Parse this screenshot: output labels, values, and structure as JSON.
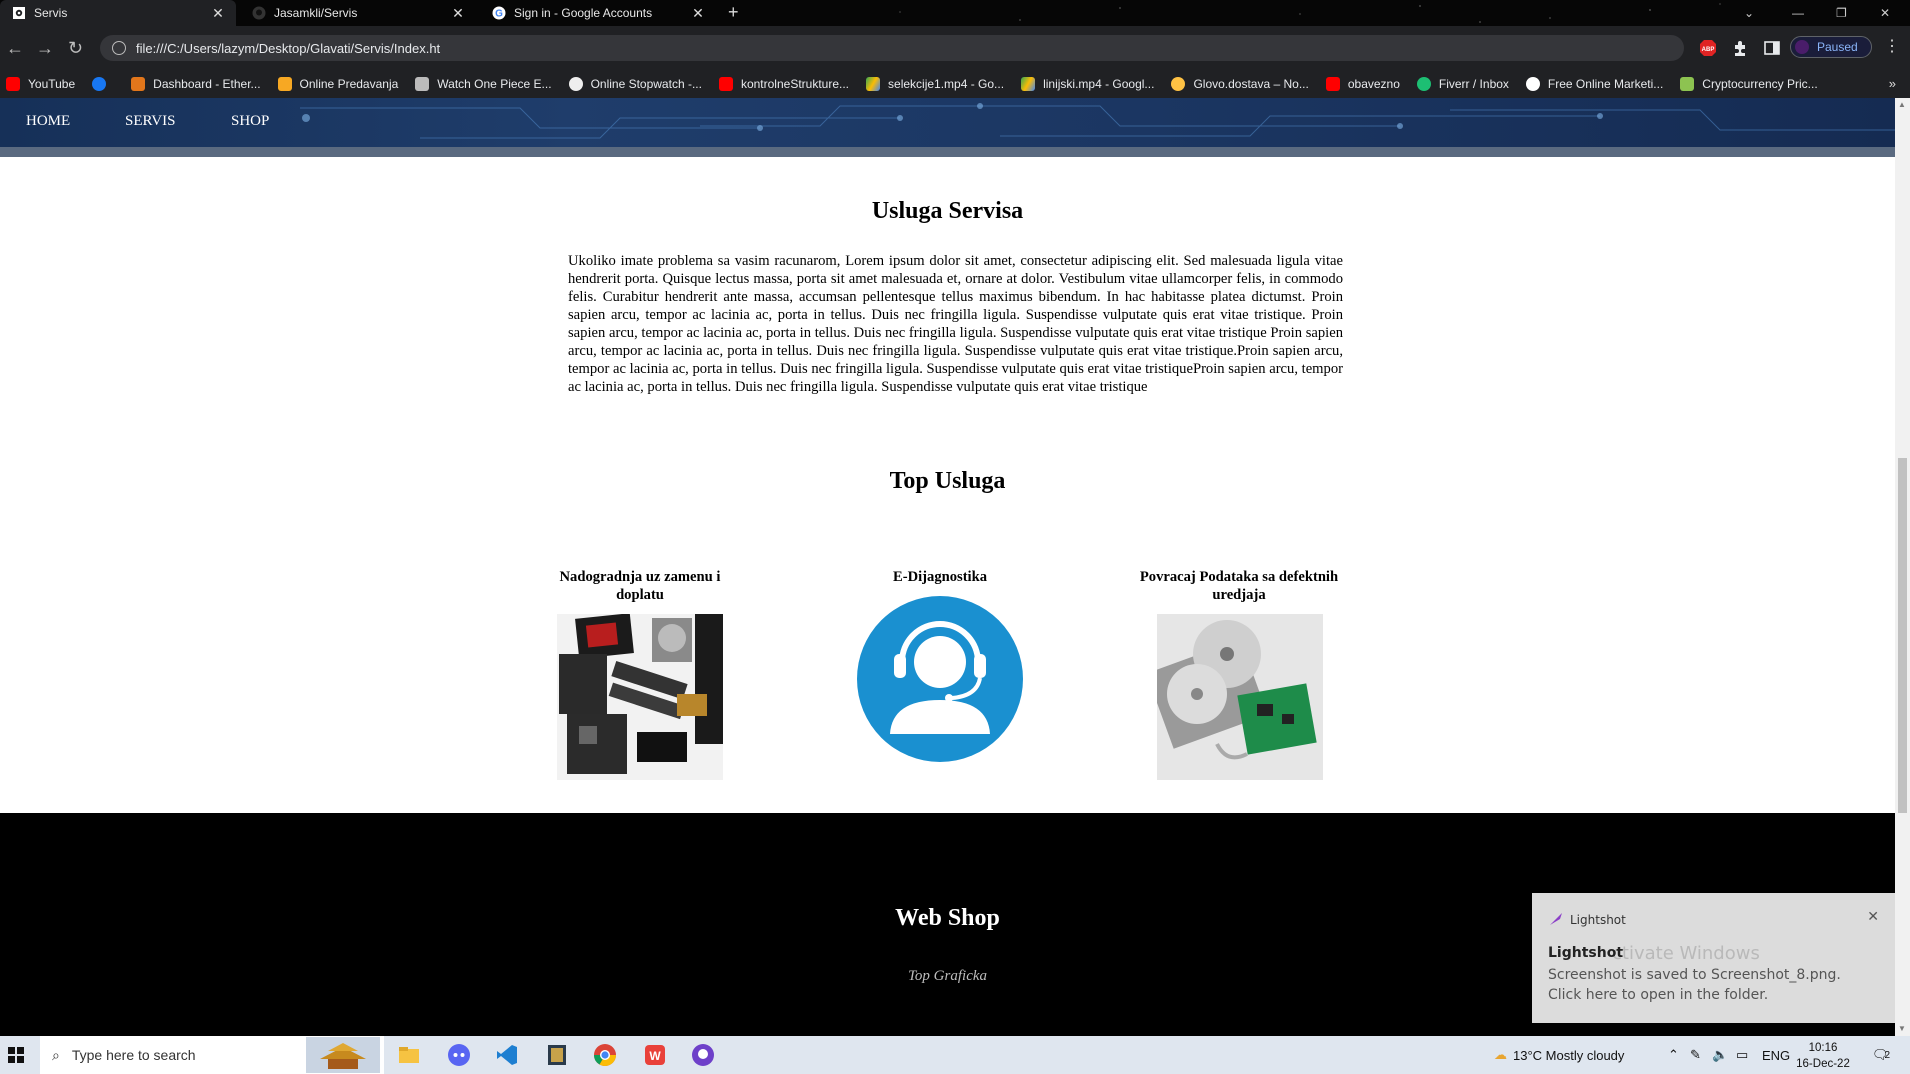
{
  "browser": {
    "tabs": [
      {
        "title": "Servis",
        "active": true,
        "icon": "gear-icon"
      },
      {
        "title": "Jasamkli/Servis",
        "active": false,
        "icon": "github-icon"
      },
      {
        "title": "Sign in - Google Accounts",
        "active": false,
        "icon": "google-icon"
      }
    ],
    "new_tab": "+",
    "url": "file:///C:/Users/lazym/Desktop/Glavati/Servis/Index.ht",
    "profile_status": "Paused",
    "bookmarks": [
      {
        "label": "YouTube",
        "color": "#ff0000"
      },
      {
        "label": "",
        "color": "#1877f2"
      },
      {
        "label": "Dashboard - Ether...",
        "color": "#e2761b"
      },
      {
        "label": "Online Predavanja",
        "color": "#f7a823"
      },
      {
        "label": "Watch One Piece E...",
        "color": "#ffffff"
      },
      {
        "label": "Online Stopwatch -...",
        "color": "#eeeeee"
      },
      {
        "label": "kontrolneStrukture...",
        "color": "#ff0000"
      },
      {
        "label": "selekcije1.mp4 - Go...",
        "color": "#34a853"
      },
      {
        "label": "linijski.mp4 - Googl...",
        "color": "#fbbc05"
      },
      {
        "label": "Glovo.dostava – No...",
        "color": "#ffc244"
      },
      {
        "label": "obavezno",
        "color": "#ff0000"
      },
      {
        "label": "Fiverr / Inbox",
        "color": "#1dbf73"
      },
      {
        "label": "Free Online Marketi...",
        "color": "#ffffff"
      },
      {
        "label": "Cryptocurrency Pric...",
        "color": "#8dc351"
      }
    ],
    "bookmarks_more": "»"
  },
  "site": {
    "nav": [
      "HOME",
      "SERVIS",
      "SHOP"
    ],
    "service_title": "Usluga Servisa",
    "service_text": "Ukoliko imate problema sa vasim racunarom, Lorem ipsum dolor sit amet, consectetur adipiscing elit. Sed malesuada ligula vitae hendrerit porta. Quisque lectus massa, porta sit amet malesuada et, ornare at dolor. Vestibulum vitae ullamcorper felis, in commodo felis. Curabitur hendrerit ante massa, accumsan pellentesque tellus maximus bibendum. In hac habitasse platea dictumst. Proin sapien arcu, tempor ac lacinia ac, porta in tellus. Duis nec fringilla ligula. Suspendisse vulputate quis erat vitae tristique. Proin sapien arcu, tempor ac lacinia ac, porta in tellus. Duis nec fringilla ligula. Suspendisse vulputate quis erat vitae tristique Proin sapien arcu, tempor ac lacinia ac, porta in tellus. Duis nec fringilla ligula. Suspendisse vulputate quis erat vitae tristique.Proin sapien arcu, tempor ac lacinia ac, porta in tellus. Duis nec fringilla ligula. Suspendisse vulputate quis erat vitae tristiqueProin sapien arcu, tempor ac lacinia ac, porta in tellus. Duis nec fringilla ligula. Suspendisse vulputate quis erat vitae tristique",
    "top_title": "Top Usluga",
    "cards": [
      {
        "title": "Nadogradnja uz zamenu i doplatu"
      },
      {
        "title": "E-Dijagnostika"
      },
      {
        "title": "Povracaj Podataka sa defektnih uredjaja"
      }
    ],
    "webshop_title": "Web Shop",
    "webshop_subtitle": "Top Graficka"
  },
  "toast": {
    "app": "Lightshot",
    "title": "Lightshot",
    "watermark": "ctivate Windows",
    "body": "Screenshot is saved to Screenshot_8.png. Click here to open in the folder."
  },
  "taskbar": {
    "search_placeholder": "Type here to search",
    "weather": "13°C  Mostly cloudy",
    "language": "ENG",
    "time": "10:16",
    "date": "16-Dec-22",
    "notifications": "2"
  }
}
